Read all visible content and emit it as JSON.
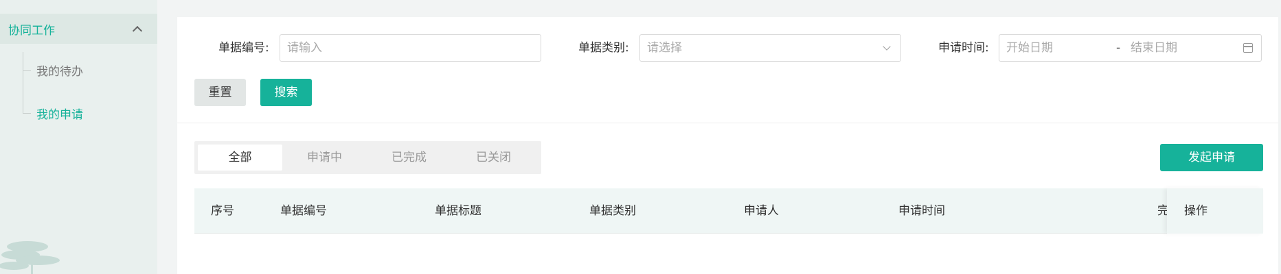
{
  "sidebar": {
    "group_label": "协同工作",
    "items": [
      {
        "label": "我的待办",
        "active": false
      },
      {
        "label": "我的申请",
        "active": true
      }
    ]
  },
  "filters": {
    "doc_no_label": "单据编号:",
    "doc_no_placeholder": "请输入",
    "doc_type_label": "单据类别:",
    "doc_type_placeholder": "请选择",
    "apply_time_label": "申请时间:",
    "start_placeholder": "开始日期",
    "date_separator": "-",
    "end_placeholder": "结束日期"
  },
  "actions": {
    "reset_label": "重置",
    "search_label": "搜索",
    "new_request_label": "发起申请"
  },
  "tabs": [
    {
      "label": "全部",
      "active": true
    },
    {
      "label": "申请中",
      "active": false
    },
    {
      "label": "已完成",
      "active": false
    },
    {
      "label": "已关闭",
      "active": false
    }
  ],
  "table": {
    "columns": [
      "序号",
      "单据编号",
      "单据标题",
      "单据类别",
      "申请人",
      "申请时间",
      "完",
      "操作"
    ]
  },
  "colors": {
    "accent": "#16b29a",
    "sidebar_bg": "#e9f0ee",
    "table_head_bg": "#eff6f5"
  }
}
